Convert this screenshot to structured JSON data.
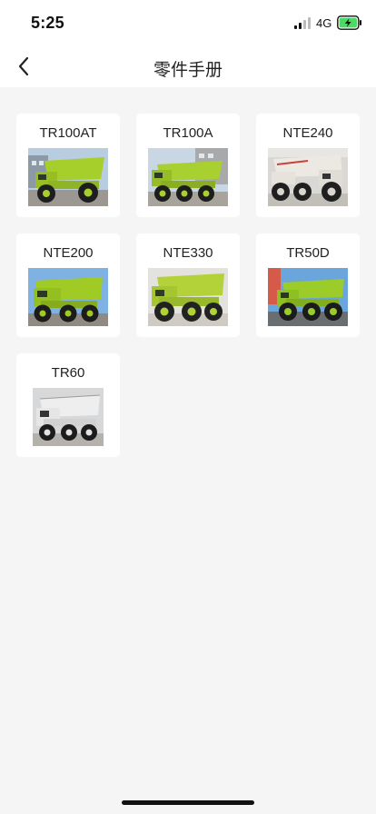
{
  "status_bar": {
    "time": "5:25",
    "network": "4G"
  },
  "nav": {
    "title": "零件手册"
  },
  "parts": [
    {
      "model": "TR100AT",
      "truck_color": "#a7cf2c",
      "background": "sky-building"
    },
    {
      "model": "TR100A",
      "truck_color": "#a9d031",
      "background": "sky-building"
    },
    {
      "model": "NTE240",
      "truck_color": "#ece9e2",
      "background": "sky-grey"
    },
    {
      "model": "NTE200",
      "truck_color": "#9fcb24",
      "background": "sky-blue"
    },
    {
      "model": "NTE330",
      "truck_color": "#b3d23a",
      "background": "sky-grey"
    },
    {
      "model": "TR50D",
      "truck_color": "#9bcc2a",
      "background": "sky-blue"
    },
    {
      "model": "TR60",
      "truck_color": "#eeeeee",
      "background": "sky-grey"
    }
  ],
  "colors": {
    "background": "#f5f5f5",
    "card": "#ffffff",
    "battery_charge": "#4cd964"
  }
}
